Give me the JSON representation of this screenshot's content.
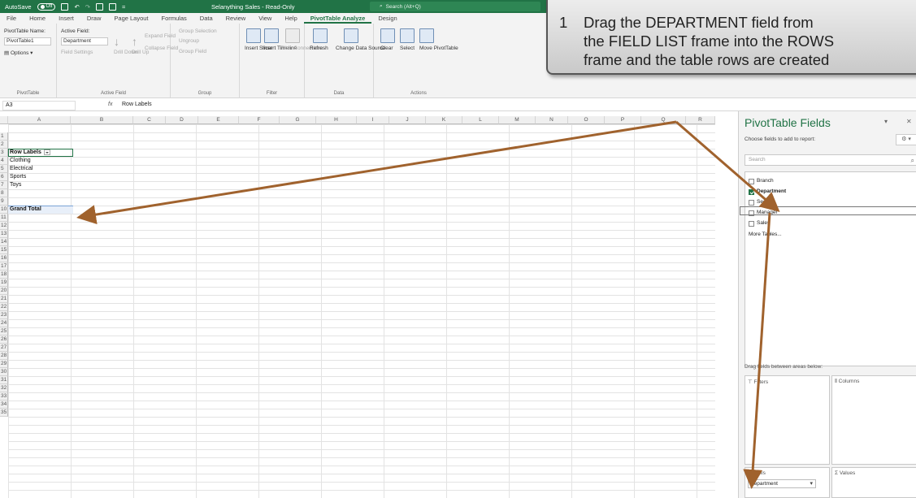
{
  "titlebar": {
    "autosave_label": "AutoSave",
    "autosave_state": "Off",
    "title": "Selanything Sales - Read-Only",
    "search_placeholder": "Search (Alt+Q)"
  },
  "tabs": [
    "File",
    "Home",
    "Insert",
    "Draw",
    "Page Layout",
    "Formulas",
    "Data",
    "Review",
    "View",
    "Help",
    "PivotTable Analyze",
    "Design"
  ],
  "ribbon": {
    "pivottable": {
      "name_label": "PivotTable Name:",
      "name_value": "PivotTable1",
      "options": "Options",
      "group": "PivotTable"
    },
    "activefield": {
      "label": "Active Field:",
      "value": "Department",
      "field_settings": "Field Settings",
      "drill_down": "Drill Down",
      "drill_up": "Drill Up",
      "expand": "Expand Field",
      "collapse": "Collapse Field",
      "group": "Active Field"
    },
    "group": {
      "selection": "Group Selection",
      "ungroup": "Ungroup",
      "field": "Group Field",
      "group": "Group"
    },
    "filter": {
      "slicer": "Insert Slicer",
      "timeline": "Insert Timeline",
      "connections": "Filter Connections",
      "group": "Filter"
    },
    "data": {
      "refresh": "Refresh",
      "change_source": "Change Data Source",
      "group": "Data"
    },
    "actions": {
      "clear": "Clear",
      "select": "Select",
      "move": "Move PivotTable",
      "group": "Actions"
    }
  },
  "formula_bar": {
    "cell_ref": "A3",
    "fx": "fx",
    "content": "Row Labels"
  },
  "columns": [
    "A",
    "B",
    "C",
    "D",
    "E",
    "F",
    "G",
    "H",
    "I",
    "J",
    "K",
    "L",
    "M",
    "N",
    "O",
    "P",
    "Q",
    "R"
  ],
  "rows": [
    "1",
    "2",
    "3",
    "4",
    "5",
    "6",
    "7",
    "8",
    "9",
    "10",
    "11",
    "12",
    "13",
    "14",
    "15",
    "16",
    "17",
    "18",
    "19",
    "20",
    "21",
    "22",
    "23",
    "24",
    "25",
    "26",
    "27",
    "28",
    "29",
    "30",
    "31",
    "32",
    "33",
    "34",
    "35"
  ],
  "cells": {
    "row_labels": "Row Labels",
    "items": [
      "Clothing",
      "Electrical",
      "Sports",
      "Toys"
    ],
    "grand_total": "Grand Total"
  },
  "pane": {
    "title": "PivotTable Fields",
    "choose": "Choose fields to add to report:",
    "search": "Search",
    "fields": [
      {
        "label": "Branch",
        "checked": false
      },
      {
        "label": "Department",
        "checked": true
      },
      {
        "label": "Section",
        "checked": false
      },
      {
        "label": "Manager",
        "checked": false
      },
      {
        "label": "Sales",
        "checked": false
      }
    ],
    "more_tables": "More Tables...",
    "drag_label": "Drag fields between areas below:",
    "filters": "Filters",
    "columns": "Columns",
    "rows": "Rows",
    "values": "Values",
    "rows_item": "Department"
  },
  "callout": {
    "number": "1",
    "text": "Drag the DEPARTMENT field from\nthe FIELD LIST frame into the ROWS\nframe and the table rows are created"
  },
  "colors": {
    "excel_green": "#217346",
    "arrow": "#a0622d"
  }
}
